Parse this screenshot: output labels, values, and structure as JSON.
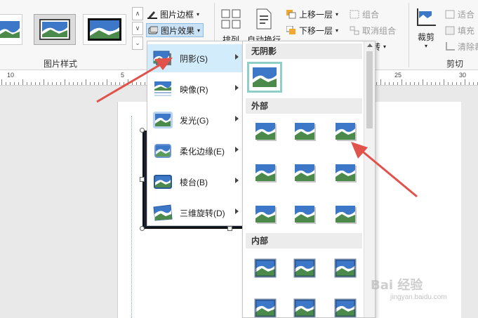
{
  "ribbon": {
    "picture_styles_label": "图片样式",
    "picture_border": "图片边框",
    "picture_effects": "图片效果",
    "arrange_label": "排列",
    "auto_wrap": "自动换行",
    "bring_forward": "上移一层",
    "send_backward": "下移一层",
    "group": "组合",
    "ungroup": "取消组合",
    "rotate_partial": "转",
    "crop": "裁剪",
    "fit": "适合",
    "fill": "填充",
    "clear_crop": "清除裁",
    "crop_group_label": "剪切"
  },
  "ruler": {
    "labels": [
      "10",
      "5",
      "25",
      "30"
    ]
  },
  "effects_menu": {
    "items": [
      {
        "label": "阴影(S)",
        "icon": "shadow-icon"
      },
      {
        "label": "映像(R)",
        "icon": "reflection-icon"
      },
      {
        "label": "发光(G)",
        "icon": "glow-icon"
      },
      {
        "label": "柔化边缘(E)",
        "icon": "soft-edges-icon"
      },
      {
        "label": "棱台(B)",
        "icon": "bevel-icon"
      },
      {
        "label": "三维旋转(D)",
        "icon": "3d-rotation-icon"
      }
    ]
  },
  "shadow_menu": {
    "no_shadow": "无阴影",
    "outer": "外部",
    "inner": "内部"
  },
  "watermark": {
    "text": "Bai 经验",
    "sub": "jingyan.baidu.com"
  },
  "colors": {
    "accent_blue": "#3a6eb0",
    "hover": "#d3ecfb",
    "arrow": "#e0524a"
  }
}
